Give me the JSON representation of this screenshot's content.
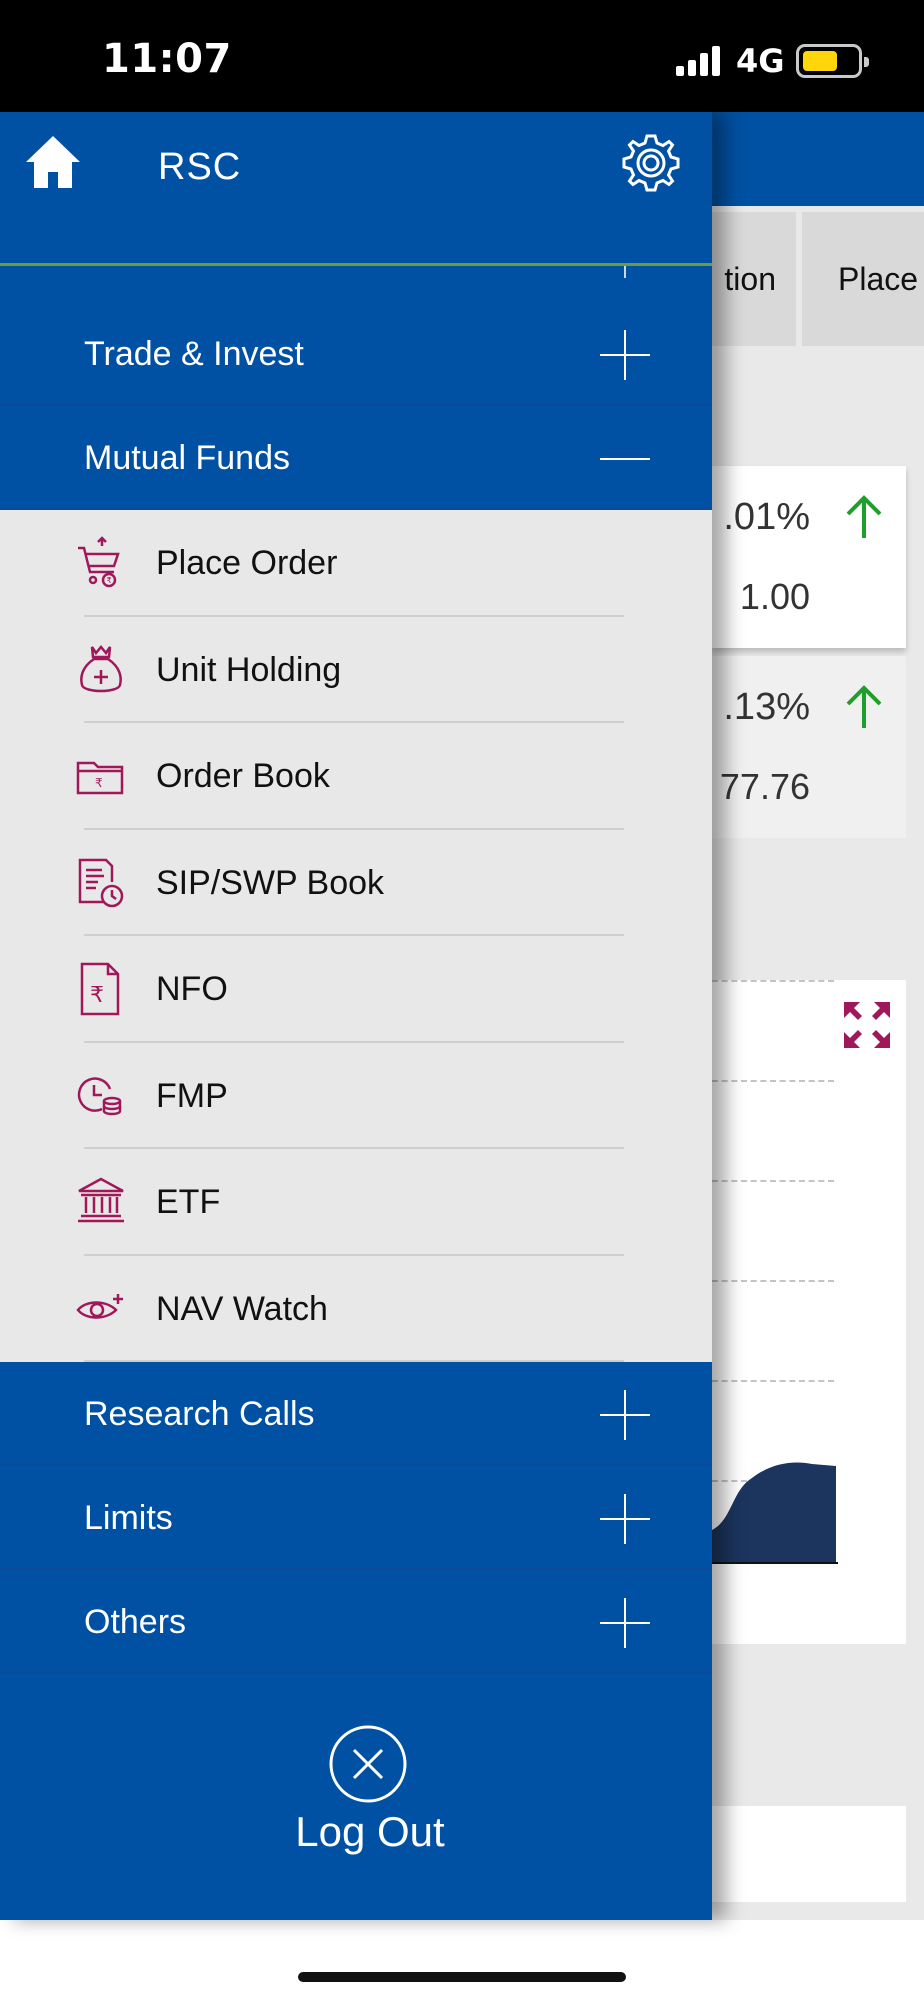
{
  "status_bar": {
    "time": "11:07",
    "network": "4G",
    "battery_color": "#ffd60a"
  },
  "drawer": {
    "title": "RSC",
    "home_icon": "home-icon",
    "settings_icon": "gear-icon",
    "sections": [
      {
        "label": "Trade & Invest",
        "state": "collapsed"
      },
      {
        "label": "Mutual Funds",
        "state": "expanded"
      },
      {
        "label": "Research Calls",
        "state": "collapsed"
      },
      {
        "label": "Limits",
        "state": "collapsed"
      },
      {
        "label": "Others",
        "state": "collapsed"
      }
    ],
    "mutual_funds_items": [
      {
        "label": "Place Order",
        "icon": "cart-icon"
      },
      {
        "label": "Unit Holding",
        "icon": "money-bag-icon"
      },
      {
        "label": "Order Book",
        "icon": "folder-rupee-icon"
      },
      {
        "label": "SIP/SWP Book",
        "icon": "document-clock-icon"
      },
      {
        "label": "NFO",
        "icon": "document-rupee-icon"
      },
      {
        "label": "FMP",
        "icon": "clock-coins-icon"
      },
      {
        "label": "ETF",
        "icon": "bank-icon"
      },
      {
        "label": "NAV Watch",
        "icon": "eye-plus-icon"
      }
    ],
    "logout": {
      "label": "Log Out",
      "icon": "close-circle-icon"
    },
    "colors": {
      "primary": "#0051a3",
      "submenu_bg": "#e8e8e8",
      "icon_accent": "#a0185a"
    }
  },
  "background": {
    "tabs": [
      "tion",
      "Place"
    ],
    "cards": [
      {
        "pct": ".01%",
        "value": "1.00"
      },
      {
        "pct": ".13%",
        "value": "77.76"
      }
    ],
    "up_color": "#1e9e2a",
    "expand_icon": "expand-icon"
  }
}
